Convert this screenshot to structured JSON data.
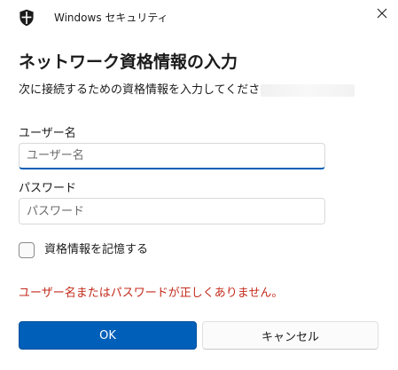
{
  "window": {
    "title": "Windows セキュリティ",
    "icon": "shield-icon",
    "close_icon": "close-icon"
  },
  "dialog": {
    "heading": "ネットワーク資格情報の入力",
    "instruction": "次に接続するための資格情報を入力してください:"
  },
  "username": {
    "label": "ユーザー名",
    "placeholder": "ユーザー名",
    "value": ""
  },
  "password": {
    "label": "パスワード",
    "placeholder": "パスワード",
    "value": ""
  },
  "remember": {
    "label": "資格情報を記憶する",
    "checked": false
  },
  "error": {
    "message": "ユーザー名またはパスワードが正しくありません。"
  },
  "buttons": {
    "ok": "OK",
    "cancel": "キャンセル"
  },
  "colors": {
    "accent": "#005fb8",
    "error": "#c42b1c",
    "background": "#ffffff"
  }
}
